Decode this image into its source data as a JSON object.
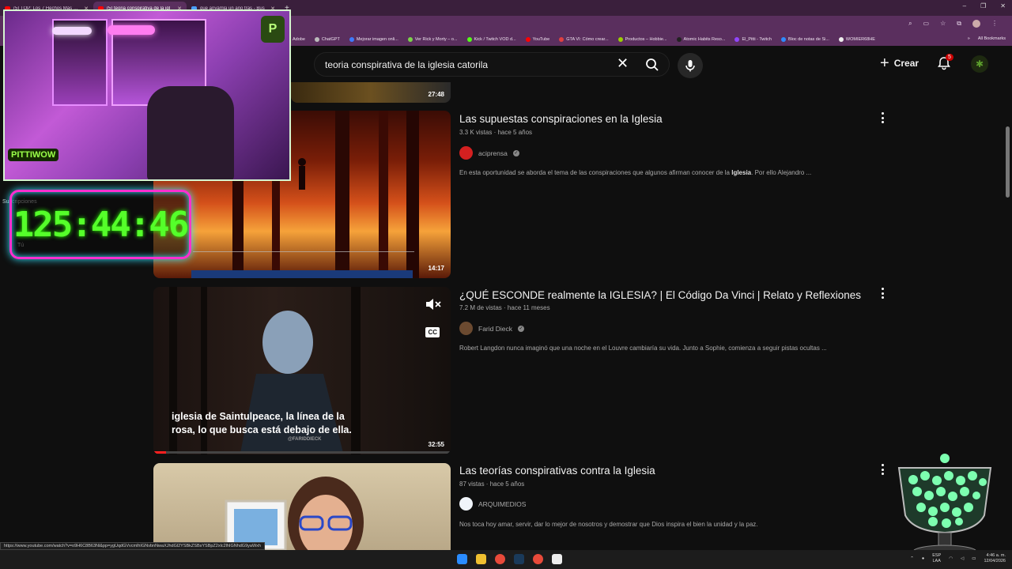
{
  "browser": {
    "tabs": [
      {
        "label": "(5) TOP: Los 7 Hechos Más Pert",
        "active": false
      },
      {
        "label": "(5) teoria conspirativa de la igl",
        "active": true
      },
      {
        "label": "que anyámla un año tras - Bus",
        "active": false
      }
    ],
    "new_tab": "+",
    "window_controls": [
      "–",
      "❐",
      "✕"
    ],
    "bookmarks": [
      "Adobe",
      "ChatGPT",
      "Mejorar imagen onli...",
      "Ver Rick y Morty – o...",
      "Kick / Twitch VOD d...",
      "YouTube",
      "GTA VI: Cómo crear...",
      "Productos – Hobbie...",
      "Atomic Habits Reso...",
      "El_Pitti - Twitch",
      "Bloc de notas de Si...",
      "WOMIER68HE"
    ],
    "bookmarks_more": "»",
    "all_bookmarks": "All Bookmarks"
  },
  "youtube": {
    "search": {
      "query": "teoria conspirativa de la iglesia catorila"
    },
    "create_label": "Crear",
    "notifications_count": "5"
  },
  "results": [
    {
      "duration": "27:48"
    },
    {
      "title": "Las supuestas conspiraciones en la Iglesia",
      "views": "3.3 K vistas",
      "age": "hace 5 años",
      "channel": "aciprensa",
      "description_pre": "En esta oportunidad se aborda el tema de las conspiraciones que algunos afirman conocer de la ",
      "description_bold": "Iglesia",
      "description_post": ". Por ello Alejandro ...",
      "duration": "14:17"
    },
    {
      "title": "¿QUÉ ESCONDE realmente la IGLESIA? | El Código Da Vinci | Relato y Reflexiones",
      "views": "7.2 M de vistas",
      "age": "hace 11 meses",
      "channel": "Farid Dieck",
      "description": "Robert Langdon nunca imaginó que una noche en el Louvre cambiaría su vida. Junto a Sophie, comienza a seguir pistas ocultas ...",
      "subtitle_line1": "iglesia de Saintulpeace, la línea de la",
      "subtitle_line2": "rosa, lo que busca está debajo de ella.",
      "watermark": "@FARIDDIECK",
      "cc": "CC",
      "duration": "32:55"
    },
    {
      "title": "Las teorías conspirativas contra la Iglesia",
      "views": "87 vistas",
      "age": "hace 5 años",
      "channel": "ARQUIMEDIOS",
      "description": "Nos toca hoy amar, servir, dar lo mejor de nosotros y demostrar que Dios inspira el bien la unidad y la paz."
    }
  ],
  "overlay": {
    "timer": "125:44:46",
    "streamer_logo": "PITTIWOW",
    "corner_logo": "P"
  },
  "sidebar": {
    "subscriptions_label": "Suscripciones",
    "you_label": "Tú"
  },
  "status_url": "https://www.youtube.com/watch?v=o9H6C8B63Nl&pp=ygUqdGVvcmlhIGNvbnNwaXJhdGl2YSBkZSBsYSBpZ2xlc2lhIGNhdG9yaWxh",
  "taskbar": {
    "lang_top": "ESP",
    "lang_bottom": "LAA",
    "time": "4:46 a. m.",
    "date": "12/04/2026"
  },
  "colors": {
    "youtube_red": "#ff0000",
    "timer_green": "#55ff2a",
    "timer_border": "#ff2fd0",
    "chrome_purple": "#5a2f5e"
  }
}
